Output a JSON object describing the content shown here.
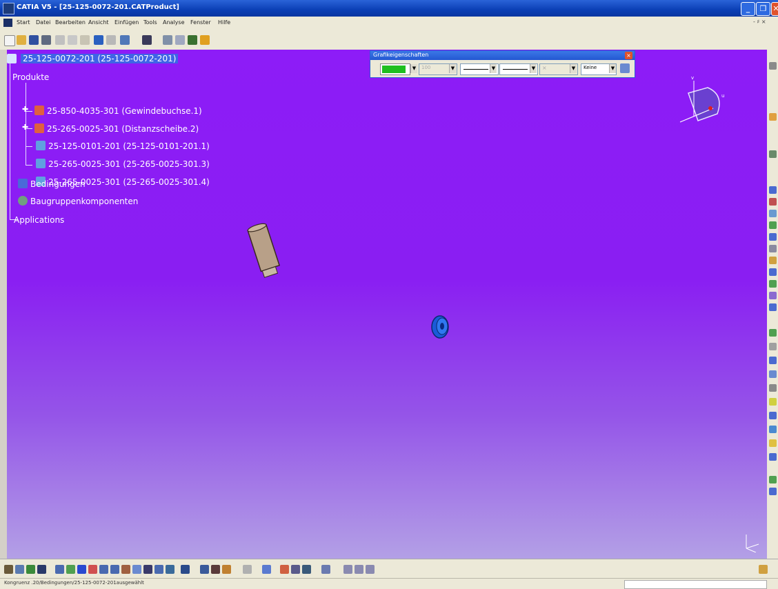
{
  "window": {
    "title": "CATIA V5 - [25-125-0072-201.CATProduct]",
    "min_glyph": "_",
    "max_glyph": "❐",
    "close_glyph": "✕"
  },
  "menu": {
    "items": [
      "Start",
      "Datei",
      "Bearbeiten",
      "Ansicht",
      "Einfügen",
      "Tools",
      "Analyse",
      "Fenster",
      "Hilfe"
    ],
    "right_controls": "- ♯ ×"
  },
  "tree": {
    "root": "25-125-0072-201 (25-125-0072-201)",
    "products_label": "Produkte",
    "products": [
      "25-850-4035-301 (Gewindebuchse.1)",
      "25-265-0025-301 (Distanzscheibe.2)",
      "25-125-0101-201 (25-125-0101-201.1)",
      "25-265-0025-301 (25-265-0025-301.3)",
      "25-265-0025-301 (25-265-0025-301.4)"
    ],
    "constraints_label": "Bedingungen",
    "components_label": "Baugruppenkomponenten",
    "applications_label": "Applications"
  },
  "graphic_properties": {
    "title": "Grafikeigenschaften",
    "fill_color": "#1fbf1f",
    "transparency": "100",
    "layer": "Keine"
  },
  "compass": {
    "v_label": "v",
    "u_label": "u"
  },
  "status": {
    "text": "Kongruenz .20/Bedingungen/25-125-0072-201ausgewählt"
  },
  "colors": {
    "viewport_top": "#8d1cf7",
    "viewport_bottom": "#b3a0e6",
    "accent": "#2b5ed6"
  }
}
